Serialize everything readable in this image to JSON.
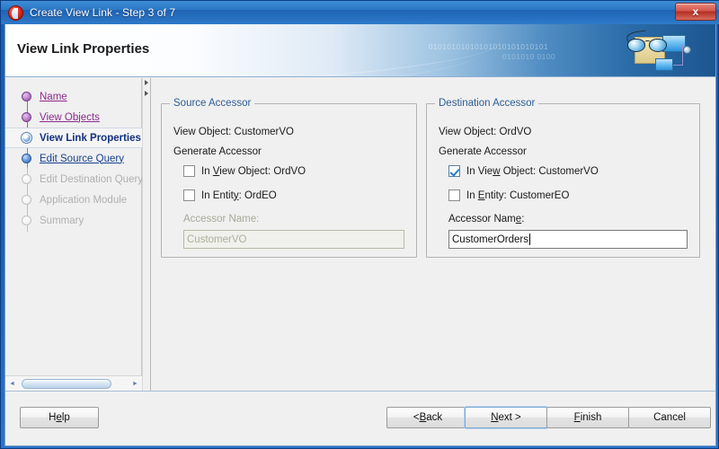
{
  "window": {
    "title": "Create View Link - Step 3 of 7",
    "app_icon": "oracle-jdeveloper-icon",
    "close_label": "x"
  },
  "banner": {
    "heading": "View Link Properties",
    "binary_decor_1": "01010101010101010101010101",
    "binary_decor_2": "0101010 0100",
    "artwork": "glasses-and-windows-icon"
  },
  "sidebar": {
    "steps": [
      {
        "label": "Name",
        "state": "done"
      },
      {
        "label": "View Objects",
        "state": "done"
      },
      {
        "label": "View Link Properties",
        "state": "current"
      },
      {
        "label": "Edit Source Query",
        "state": "next"
      },
      {
        "label": "Edit Destination Query",
        "state": "pending"
      },
      {
        "label": "Application Module",
        "state": "pending"
      },
      {
        "label": "Summary",
        "state": "pending"
      }
    ]
  },
  "source_accessor": {
    "group_title": "Source Accessor",
    "view_object_line": "View Object: CustomerVO",
    "generate_accessor_label": "Generate Accessor",
    "checkbox_view_object": {
      "prefix": "In ",
      "mnemonic": "V",
      "suffix": "iew Object: OrdVO",
      "checked": false
    },
    "checkbox_entity": {
      "prefix": "In Entit",
      "mnemonic": "y",
      "suffix": ": OrdEO",
      "checked": false
    },
    "accessor_name_label": "Accessor Name:",
    "accessor_name_value": "CustomerVO",
    "disabled": true
  },
  "destination_accessor": {
    "group_title": "Destination Accessor",
    "view_object_line": "View Object: OrdVO",
    "generate_accessor_label": "Generate Accessor",
    "checkbox_view_object": {
      "prefix": "In Vie",
      "mnemonic": "w",
      "suffix": " Object: CustomerVO",
      "checked": true
    },
    "checkbox_entity": {
      "prefix": "In ",
      "mnemonic": "E",
      "suffix": "ntity: CustomerEO",
      "checked": false
    },
    "accessor_name_label_prefix": "Accessor Nam",
    "accessor_name_label_mnemonic": "e",
    "accessor_name_label_suffix": ":",
    "accessor_name_value": "CustomerOrders",
    "focused": true
  },
  "buttons": {
    "help": {
      "prefix": "H",
      "mnemonic": "e",
      "suffix": "lp"
    },
    "back": {
      "prefix": "< ",
      "mnemonic": "B",
      "suffix": "ack"
    },
    "next": {
      "prefix": "",
      "mnemonic": "N",
      "suffix": "ext >"
    },
    "finish": {
      "prefix": "",
      "mnemonic": "F",
      "suffix": "inish"
    },
    "cancel": {
      "prefix": "",
      "mnemonic": "",
      "suffix": "Cancel"
    }
  },
  "scrollbar": {
    "left_arrow": "◄",
    "right_arrow": "►"
  },
  "colors": {
    "title_bar_blue": "#2c77c6",
    "link_done_purple": "#8c2a8c",
    "link_next_blue": "#17408f",
    "current_step_navy": "#10307d",
    "group_title_blue": "#2c5d96",
    "checkbox_check_blue": "#2a7ec8",
    "close_button_red": "#b32f22"
  }
}
